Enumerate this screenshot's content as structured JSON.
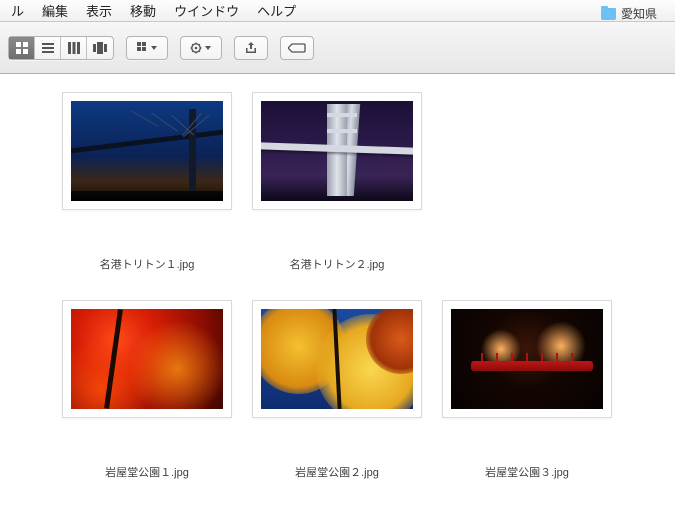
{
  "menubar": {
    "items": [
      "ル",
      "編集",
      "表示",
      "移動",
      "ウインドウ",
      "ヘルプ"
    ]
  },
  "window": {
    "folder_name": "愛知県"
  },
  "files": [
    {
      "name": "名港トリトン１.jpg"
    },
    {
      "name": "名港トリトン２.jpg"
    },
    {
      "name": "岩屋堂公園１.jpg"
    },
    {
      "name": "岩屋堂公園２.jpg"
    },
    {
      "name": "岩屋堂公園３.jpg"
    }
  ]
}
